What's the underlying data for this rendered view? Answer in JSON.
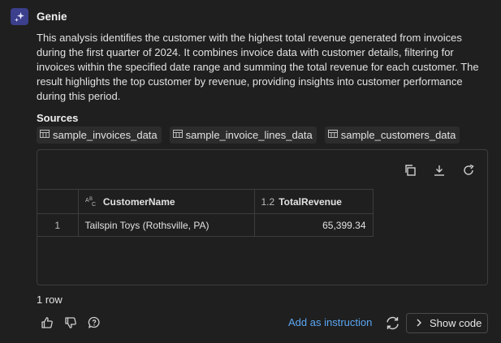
{
  "assistant": {
    "name": "Genie",
    "icon": "sparkle-icon",
    "accent_color": "#3b3f8c"
  },
  "message": {
    "text": "This analysis identifies the customer with the highest total revenue generated from invoices during the first quarter of 2024. It combines invoice data with customer details, filtering for invoices within the specified date range and summing the total revenue for each customer. The result highlights the top customer by revenue, providing insights into customer performance during this period."
  },
  "sources": {
    "label": "Sources",
    "items": [
      {
        "name": "sample_invoices_data",
        "icon": "table-icon"
      },
      {
        "name": "sample_invoice_lines_data",
        "icon": "table-icon"
      },
      {
        "name": "sample_customers_data",
        "icon": "table-icon"
      }
    ]
  },
  "toolbar": {
    "icons": [
      "copy-icon",
      "download-icon",
      "refresh-icon"
    ]
  },
  "table": {
    "columns": [
      {
        "type_tag": "",
        "label": ""
      },
      {
        "type_tag": "ABC",
        "label": "CustomerName"
      },
      {
        "type_tag": "1.2",
        "label": "TotalRevenue"
      }
    ],
    "rows": [
      {
        "index": "1",
        "customer_name": "Tailspin Toys (Rothsville, PA)",
        "total_revenue": "65,399.34"
      }
    ]
  },
  "footer": {
    "row_count": "1 row",
    "add_instruction_label": "Add as instruction",
    "show_code_label": "Show code",
    "link_color": "#5ba6f2"
  }
}
